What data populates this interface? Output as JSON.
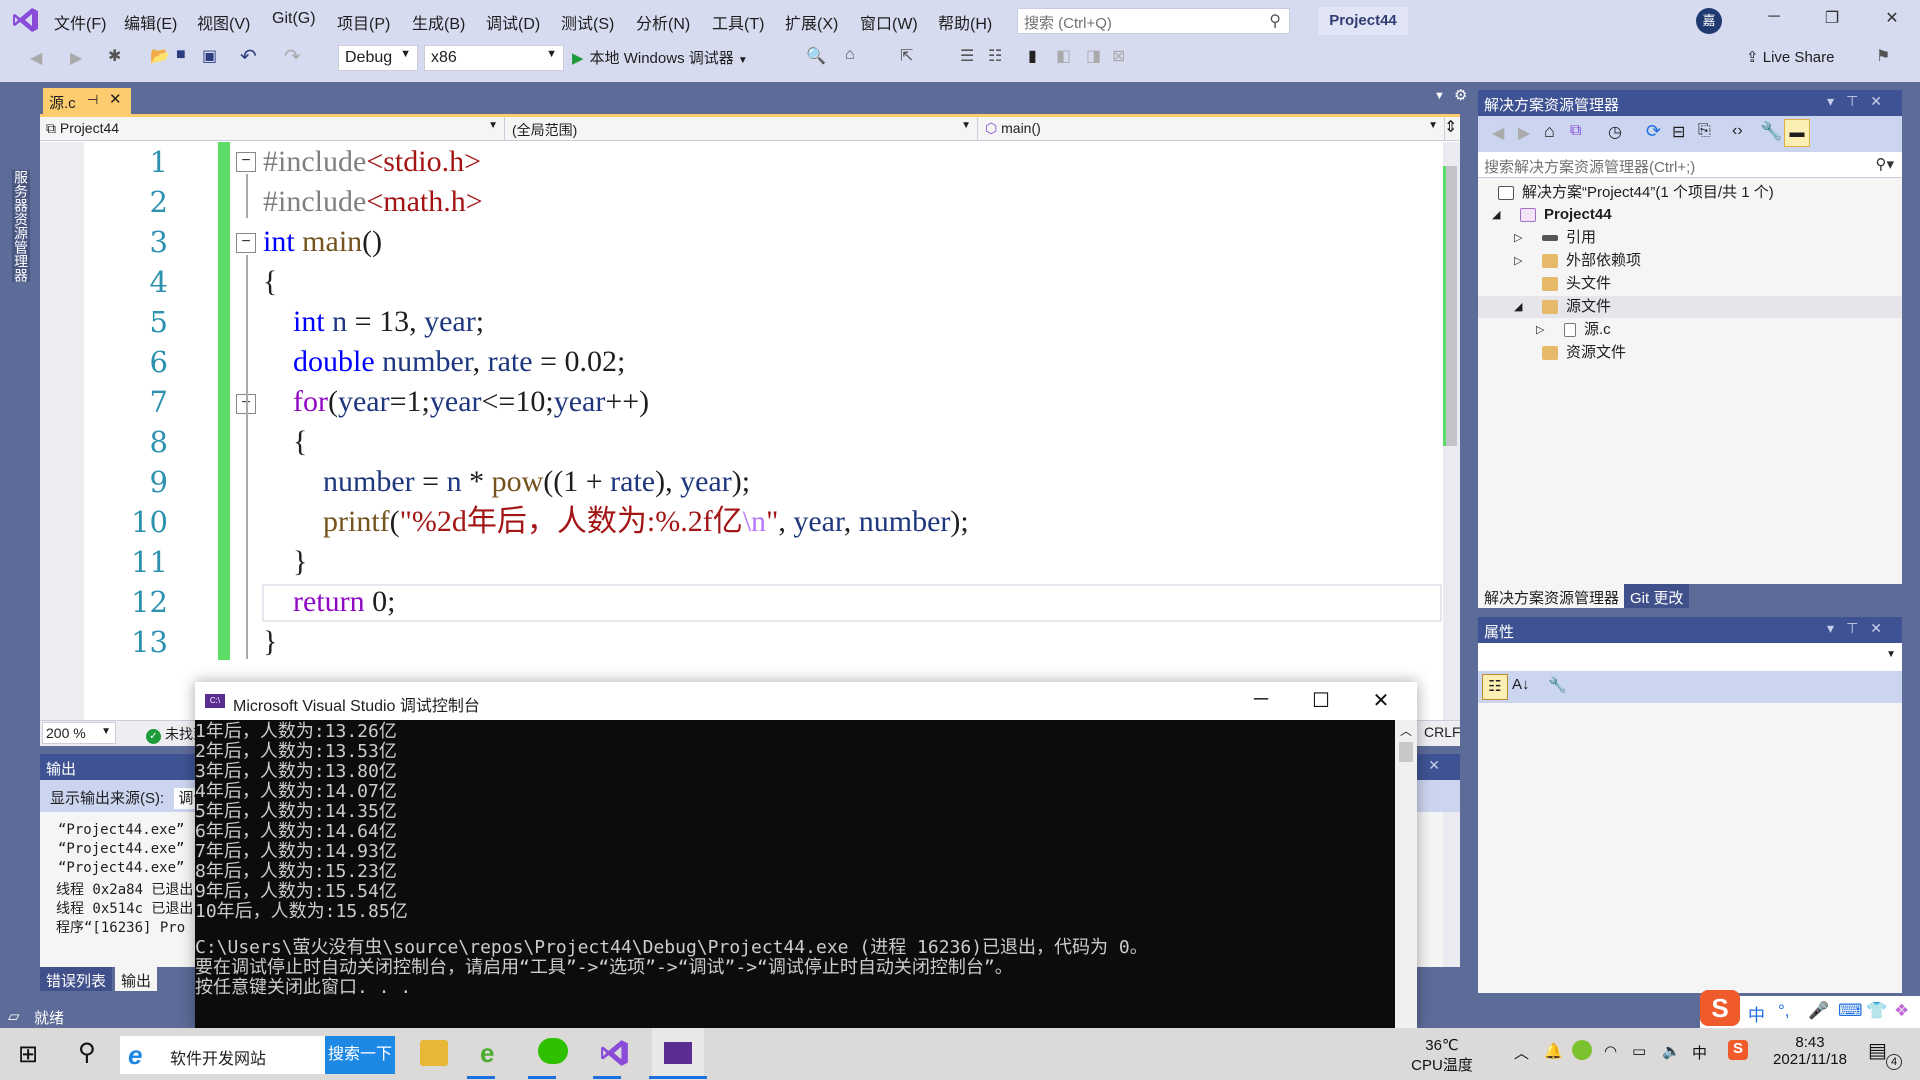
{
  "menubar": {
    "items": [
      "文件(F)",
      "编辑(E)",
      "视图(V)",
      "Git(G)",
      "项目(P)",
      "生成(B)",
      "调试(D)",
      "测试(S)",
      "分析(N)",
      "工具(T)",
      "扩展(X)",
      "窗口(W)",
      "帮助(H)"
    ],
    "search_placeholder": "搜索 (Ctrl+Q)",
    "project_title": "Project44",
    "avatar_initial": "嘉"
  },
  "toolbar": {
    "config": "Debug",
    "platform": "x86",
    "run_label": "本地 Windows 调试器",
    "live_share": "Live Share"
  },
  "left_strip": {
    "tab_label": "服务器资源管理器"
  },
  "editor": {
    "tab_label": "源.c",
    "nav_project": "Project44",
    "nav_scope": "(全局范围)",
    "nav_member": "main()",
    "line_numbers": [
      "1",
      "2",
      "3",
      "4",
      "5",
      "6",
      "7",
      "8",
      "9",
      "10",
      "11",
      "12",
      "13"
    ],
    "code": [
      "#include<stdio.h>",
      "#include<math.h>",
      "int main()",
      "{",
      "    int n = 13, year;",
      "    double number, rate = 0.02;",
      "    for(year=1;year<=10;year++)",
      "    {",
      "        number = n * pow((1 + rate), year);",
      "        printf(\"%2d年后，人数为:%.2f亿\\n\", year, number);",
      "    }",
      "    return 0;",
      "}"
    ],
    "zoom": "200 %",
    "issues": "未找到相关问题",
    "line_ending": "CRLF"
  },
  "output": {
    "title": "输出",
    "source_label": "显示输出来源(S):",
    "source_value": "调试",
    "lines": [
      "“Project44.exe”",
      "“Project44.exe”",
      "“Project44.exe”",
      "线程 0x2a84 已退出",
      "线程 0x514c 已退出",
      "程序“[16236] Pro"
    ],
    "tabs": [
      "错误列表",
      "输出"
    ]
  },
  "statusbar": {
    "ready": "就绪"
  },
  "console": {
    "title": "Microsoft Visual Studio 调试控制台",
    "icon_text": "C:\\",
    "results": [
      "1年后，人数为:13.26亿",
      "2年后，人数为:13.53亿",
      "3年后，人数为:13.80亿",
      "4年后，人数为:14.07亿",
      "5年后，人数为:14.35亿",
      "6年后，人数为:14.64亿",
      "7年后，人数为:14.93亿",
      "8年后，人数为:15.23亿",
      "9年后，人数为:15.54亿",
      "10年后，人数为:15.85亿"
    ],
    "exit_lines": [
      "C:\\Users\\萤火没有虫\\source\\repos\\Project44\\Debug\\Project44.exe (进程 16236)已退出，代码为 0。",
      "要在调试停止时自动关闭控制台，请启用“工具”->“选项”->“调试”->“调试停止时自动关闭控制台”。",
      "按任意键关闭此窗口. . ."
    ]
  },
  "solution_explorer": {
    "title": "解决方案资源管理器",
    "search_placeholder": "搜索解决方案资源管理器(Ctrl+;)",
    "tree": [
      {
        "label": "解决方案“Project44”(1 个项目/共 1 个)",
        "level": 0
      },
      {
        "label": "Project44",
        "level": 1
      },
      {
        "label": "引用",
        "level": 2
      },
      {
        "label": "外部依赖项",
        "level": 2
      },
      {
        "label": "头文件",
        "level": 2
      },
      {
        "label": "源文件",
        "level": 2
      },
      {
        "label": "源.c",
        "level": 3
      },
      {
        "label": "资源文件",
        "level": 2
      }
    ],
    "tabs": [
      "解决方案资源管理器",
      "Git 更改"
    ]
  },
  "properties": {
    "title": "属性"
  },
  "ime": {
    "items": [
      "中",
      "°,",
      "🎤",
      "⌨",
      "👕",
      "❖"
    ]
  },
  "taskbar": {
    "browser_text": "软件开发网站",
    "search_button": "搜索一下",
    "cpu_temp": "36℃",
    "cpu_label": "CPU温度",
    "ime_indicator": "中",
    "time": "8:43",
    "date": "2021/11/18",
    "notifications": "4"
  }
}
